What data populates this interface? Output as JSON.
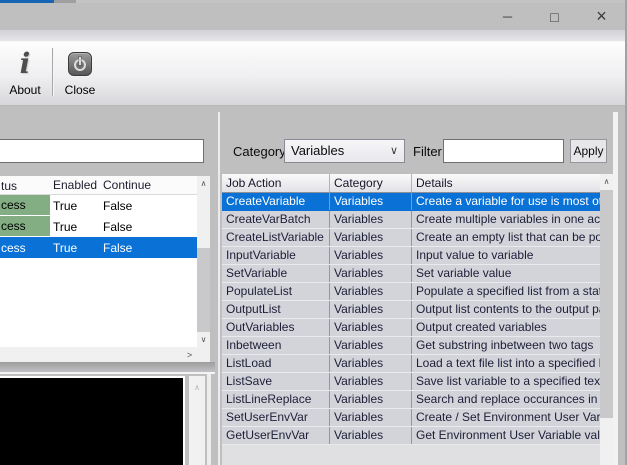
{
  "window": {
    "controls": {
      "minimize": "─",
      "maximize": "□",
      "close": "×"
    }
  },
  "toolbar": {
    "about_label": "About",
    "close_label": "Close"
  },
  "left_panel": {
    "input_value": "",
    "table": {
      "columns": [
        "tus",
        "Enabled",
        "Continue"
      ],
      "rows": [
        {
          "status": "cess",
          "enabled": "True",
          "cont": "False",
          "green": true,
          "selected": false
        },
        {
          "status": "cess",
          "enabled": "True",
          "cont": "False",
          "green": true,
          "selected": false
        },
        {
          "status": "cess",
          "enabled": "True",
          "cont": "False",
          "green": false,
          "selected": true
        }
      ]
    },
    "scroll": {
      "up": "∧",
      "down": "∨",
      "right": ">"
    }
  },
  "console_panel": {
    "scroll_up": "∧"
  },
  "right_panel": {
    "category_label": "Category",
    "category_value": "Variables",
    "chevron": "∨",
    "filter_label": "Filter",
    "filter_value": "",
    "apply_label": "Apply",
    "table": {
      "columns": [
        "Job Action",
        "Category",
        "Details"
      ],
      "rows": [
        {
          "action": "CreateVariable",
          "category": "Variables",
          "details": "Create a variable for use is most other",
          "selected": true
        },
        {
          "action": "CreateVarBatch",
          "category": "Variables",
          "details": "Create multiple variables in one action",
          "selected": false
        },
        {
          "action": "CreateListVariable",
          "category": "Variables",
          "details": "Create an empty list that can be popula",
          "selected": false
        },
        {
          "action": "InputVariable",
          "category": "Variables",
          "details": "Input value to variable",
          "selected": false
        },
        {
          "action": "SetVariable",
          "category": "Variables",
          "details": "Set variable value",
          "selected": false
        },
        {
          "action": "PopulateList",
          "category": "Variables",
          "details": "Populate a specified list from a static lis",
          "selected": false
        },
        {
          "action": "OutputList",
          "category": "Variables",
          "details": "Output list contents to the output pane",
          "selected": false
        },
        {
          "action": "OutVariables",
          "category": "Variables",
          "details": "Output created variables",
          "selected": false
        },
        {
          "action": "Inbetween",
          "category": "Variables",
          "details": "Get substring inbetween two tags",
          "selected": false
        },
        {
          "action": "ListLoad",
          "category": "Variables",
          "details": "Load a text file list into a specified list v",
          "selected": false
        },
        {
          "action": "ListSave",
          "category": "Variables",
          "details": "Save list variable to a specified text file",
          "selected": false
        },
        {
          "action": "ListLineReplace",
          "category": "Variables",
          "details": "Search and replace occurances in all lin",
          "selected": false
        },
        {
          "action": "SetUserEnvVar",
          "category": "Variables",
          "details": "Create / Set Environment User Variable",
          "selected": false
        },
        {
          "action": "GetUserEnvVar",
          "category": "Variables",
          "details": "Get Environment User Variable value",
          "selected": false
        }
      ]
    },
    "scroll": {
      "up": "∧"
    }
  },
  "colors": {
    "selection_blue": "#0a72d6",
    "status_green": "#83ad83",
    "top_strip_blue": "#1766b5"
  }
}
